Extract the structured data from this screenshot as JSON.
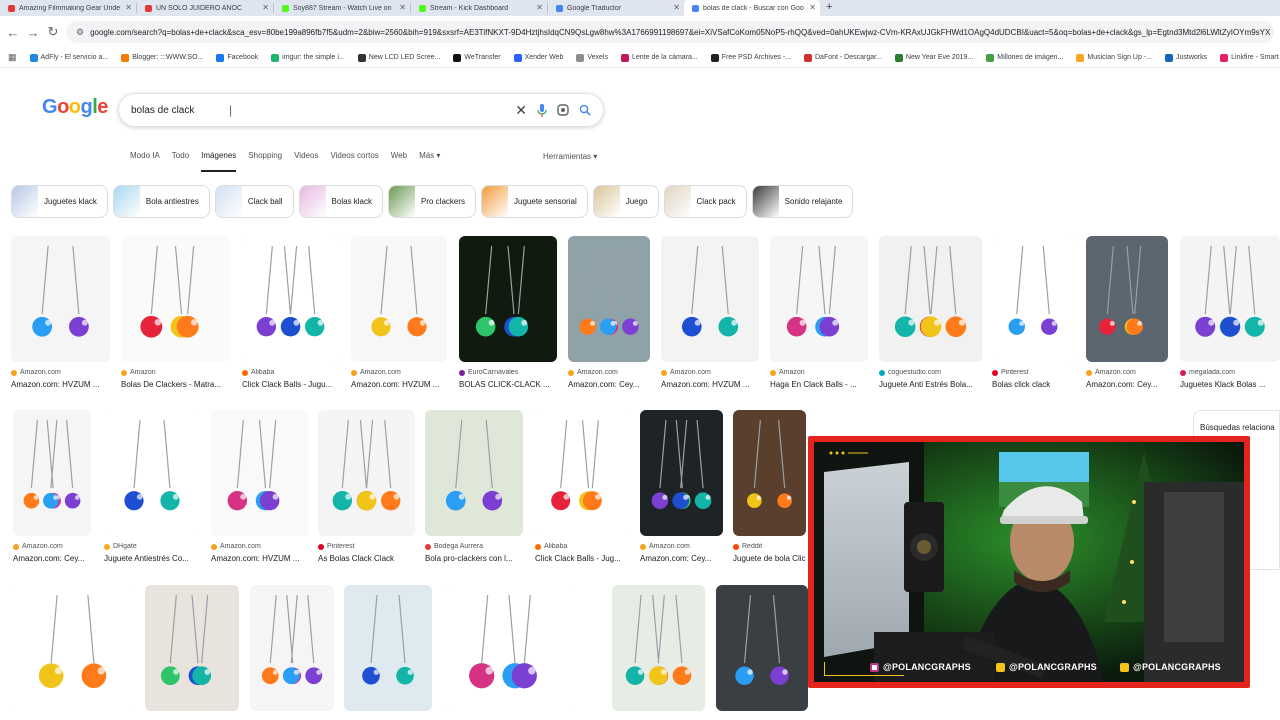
{
  "browser": {
    "tabs": [
      {
        "title": "Amazing Filmmaking Gear Unde",
        "color": "#e53935"
      },
      {
        "title": "UN SOLO JUIDERO ANOC",
        "color": "#e53935"
      },
      {
        "title": "Soy887 Stream - Watch Live on",
        "color": "#53fc18"
      },
      {
        "title": "Stream - Kick Dashboard",
        "color": "#53fc18"
      },
      {
        "title": "Google Traductor",
        "color": "#4285f4"
      },
      {
        "title": "bolas de clack - Buscar con Goo",
        "color": "#4285f4"
      }
    ],
    "new_tab": "+",
    "url": "google.com/search?q=bolas+de+clack&sca_esv=80be199a896fb7f5&udm=2&biw=2560&bih=919&sxsrf=AE3TifNKXT-9D4HztjhsIdqCN9QsLgw8hw%3A1766991198697&ei=XiVSafCoKom05NoP5-rhQQ&ved=0ahUKEwjwz-CVm-KRAxUJGkFHWd1OAgQ4dUDCBI&uact=5&oq=bolas+de+clack&gs_lp=Egtnd3Mtd2l6LWltZyIOYm9sYX"
  },
  "bookmarks": [
    {
      "label": "AdFly - El servicio a...",
      "color": "#1e88e5"
    },
    {
      "label": "Blogger: :::WWW.SO...",
      "color": "#f57c00"
    },
    {
      "label": "Facebook",
      "color": "#1877f2"
    },
    {
      "label": "imgur: the simple i...",
      "color": "#1bb76e"
    },
    {
      "label": "New LCD LED Scree...",
      "color": "#333333"
    },
    {
      "label": "WeTransfer",
      "color": "#111111"
    },
    {
      "label": "Xender Web",
      "color": "#2962ff"
    },
    {
      "label": "Vexels",
      "color": "#8d8d8d"
    },
    {
      "label": "Lente de la cámara...",
      "color": "#c2185b"
    },
    {
      "label": "Free PSD Archives -...",
      "color": "#222222"
    },
    {
      "label": "DaFont - Descargar...",
      "color": "#d32f2f"
    },
    {
      "label": "New Year Eve 2019...",
      "color": "#2e7d32"
    },
    {
      "label": "Millones de imágen...",
      "color": "#43a047"
    },
    {
      "label": "Musician Sign Up -...",
      "color": "#f9a825"
    },
    {
      "label": "Justworks",
      "color": "#1565c0"
    },
    {
      "label": "Linkfire - Smart link...",
      "color": "#e91e63"
    },
    {
      "label": "Descarga",
      "color": "#e64a19"
    }
  ],
  "google": {
    "logo": [
      "G",
      "o",
      "o",
      "g",
      "l",
      "e"
    ],
    "query": "bolas de clack",
    "tabs": [
      "Modo IA",
      "Todo",
      "Imágenes",
      "Shopping",
      "Videos",
      "Videos cortos",
      "Web",
      "Más"
    ],
    "tools": "Herramientas",
    "chips": [
      {
        "label": "Juguetes klack",
        "color": "#b6c8e8"
      },
      {
        "label": "Bola antiestres",
        "color": "#a8d8f0"
      },
      {
        "label": "Clack ball",
        "color": "#d0e0f4"
      },
      {
        "label": "Bolas klack",
        "color": "#e6b8e0"
      },
      {
        "label": "Pro clackers",
        "color": "#6c9a52"
      },
      {
        "label": "Juguete sensorial",
        "color": "#f39a3a"
      },
      {
        "label": "Juego",
        "color": "#d9c59a"
      },
      {
        "label": "Clack pack",
        "color": "#e0d4c0"
      },
      {
        "label": "Sonido relajante",
        "color": "#3a3a3a"
      }
    ],
    "related_title": "Búsquedas relaciona",
    "related_items": [
      "s en esp",
      "acker le",
      "s jugue"
    ]
  },
  "results_row1": [
    {
      "source": "Amazon.com",
      "title": "Amazon.com: HVZUM ...",
      "icon": "#f6a21a"
    },
    {
      "source": "Amazon",
      "title": "Bolas De Clackers - Matra...",
      "icon": "#f6a21a"
    },
    {
      "source": "Alibaba",
      "title": "Click Clack Balls - Jugu...",
      "icon": "#ff6a00"
    },
    {
      "source": "Amazon.com",
      "title": "Amazon.com: HVZUM ...",
      "icon": "#f6a21a"
    },
    {
      "source": "EuroCarnavales",
      "title": "BOLAS CLICK-CLACK ...",
      "icon": "#7b1fa2"
    },
    {
      "source": "Amazon.com",
      "title": "Amazon.com: Cey...",
      "icon": "#f6a21a"
    },
    {
      "source": "Amazon.com",
      "title": "Amazon.com: HVZUM ...",
      "icon": "#f6a21a"
    },
    {
      "source": "Amazon",
      "title": "Haga En Clack Balls - ...",
      "icon": "#f6a21a"
    },
    {
      "source": "coguestudio.com",
      "title": "Juguete Anti Estrés Bola...",
      "icon": "#00acc1"
    },
    {
      "source": "Pinterest",
      "title": "Bolas click clack",
      "icon": "#e60023"
    },
    {
      "source": "Amazon.com",
      "title": "Amazon.com: Cey...",
      "icon": "#f6a21a"
    },
    {
      "source": "megalada.com",
      "title": "Juguetes Klack Bolas ...",
      "icon": "#d81b60"
    }
  ],
  "results_row2": [
    {
      "source": "Amazon.com",
      "title": "Amazon.com: Cey...",
      "icon": "#f6a21a"
    },
    {
      "source": "DHgate",
      "title": "Juguete Antiestrés Co...",
      "icon": "#f9a825"
    },
    {
      "source": "Amazon.com",
      "title": "Amazon.com: HVZUM ...",
      "icon": "#f6a21a"
    },
    {
      "source": "Pinterest",
      "title": "As Bolas Clack Clack",
      "icon": "#e60023"
    },
    {
      "source": "Bodega Aurrera",
      "title": "Bola pro-clackers con l...",
      "icon": "#e53935"
    },
    {
      "source": "Alibaba",
      "title": "Click Clack Balls - Jug...",
      "icon": "#ff6a00"
    },
    {
      "source": "Amazon.com",
      "title": "Amazon.com: Cey...",
      "icon": "#f6a21a"
    },
    {
      "source": "Reddit",
      "title": "Juguete de bola Clic",
      "icon": "#ff4500"
    }
  ],
  "overlay": {
    "handles": [
      "@POLANCGRAPHS",
      "@POLANCGRAPHS",
      "@POLANCGRAPHS"
    ],
    "frame_color": "#e2241c",
    "accent_color": "#f4c21a"
  }
}
